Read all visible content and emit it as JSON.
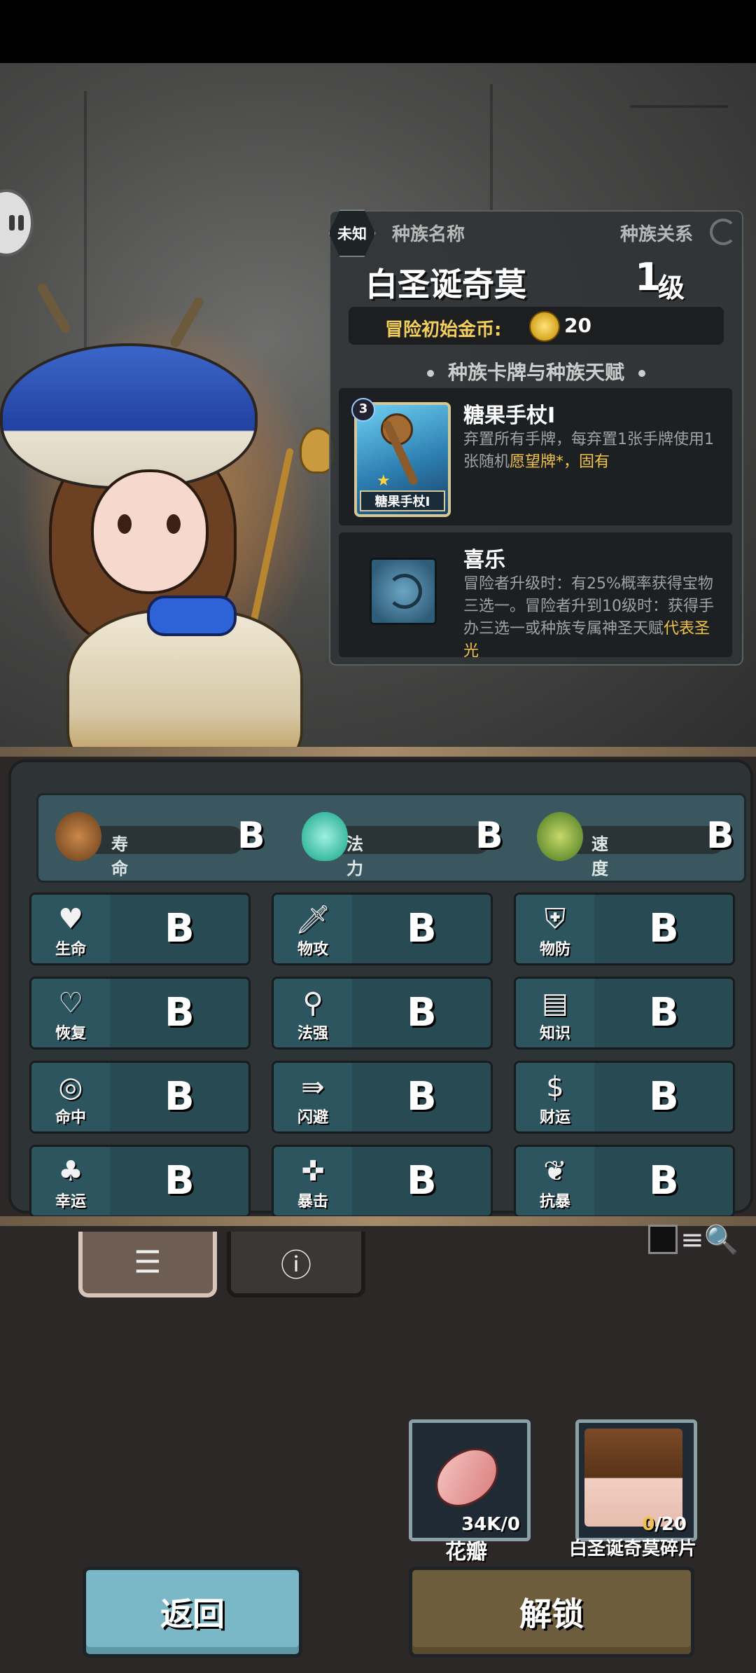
{
  "header": {
    "unknown_badge": "未知",
    "race_name_label": "种族名称",
    "race_relation_label": "种族关系"
  },
  "character": {
    "name": "白圣诞奇莫",
    "level": "1",
    "level_unit": "级"
  },
  "gold": {
    "label": "冒险初始金币:",
    "value": "20"
  },
  "section_title": "种族卡牌与种族天赋",
  "card": {
    "cost": "3",
    "thumb_label": "糖果手杖I",
    "title": "糖果手杖I",
    "desc_main": "弃置所有手牌，每弃置1张手牌使用1张随机",
    "desc_hl": "愿望牌*",
    "desc_tail": "，固有"
  },
  "talent": {
    "title": "喜乐",
    "desc_main": "冒险者升级时：有25%概率获得宝物三选一。冒险者升到10级时：获得手办三选一或种族专属神圣天赋",
    "desc_hl": "代表圣光"
  },
  "top_stats": [
    {
      "icon": "acorn-icon",
      "label": "寿命",
      "grade": "B"
    },
    {
      "icon": "flame-icon",
      "label": "法力",
      "grade": "B"
    },
    {
      "icon": "wing-icon",
      "label": "速度",
      "grade": "B"
    }
  ],
  "stats": [
    {
      "icon": "heart-icon",
      "label": "生命",
      "grade": "B"
    },
    {
      "icon": "sword-icon",
      "label": "物攻",
      "grade": "B"
    },
    {
      "icon": "armor-icon",
      "label": "物防",
      "grade": "B"
    },
    {
      "icon": "heal-icon",
      "label": "恢复",
      "grade": "B"
    },
    {
      "icon": "wand-icon",
      "label": "法强",
      "grade": "B"
    },
    {
      "icon": "book-icon",
      "label": "知识",
      "grade": "B"
    },
    {
      "icon": "target-icon",
      "label": "命中",
      "grade": "B"
    },
    {
      "icon": "dodge-icon",
      "label": "闪避",
      "grade": "B"
    },
    {
      "icon": "coin-icon",
      "label": "财运",
      "grade": "B"
    },
    {
      "icon": "clover-icon",
      "label": "幸运",
      "grade": "B"
    },
    {
      "icon": "crit-icon",
      "label": "暴击",
      "grade": "B"
    },
    {
      "icon": "shield-icon",
      "label": "抗暴",
      "grade": "B"
    }
  ],
  "materials": [
    {
      "name": "花瓣",
      "count": "34K/0"
    },
    {
      "name": "白圣诞奇莫碎片",
      "count_have": "0",
      "count_need": "/20"
    }
  ],
  "buttons": {
    "back": "返回",
    "unlock": "解锁"
  }
}
